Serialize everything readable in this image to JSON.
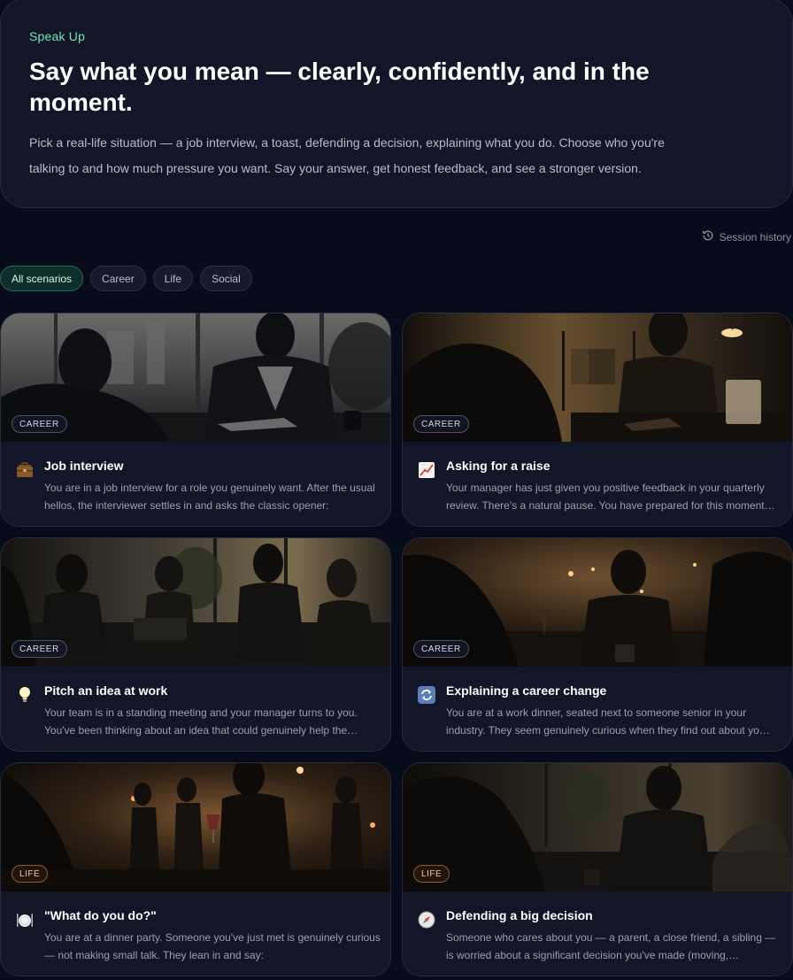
{
  "hero": {
    "eyebrow": "Speak Up",
    "title": "Say what you mean — clearly, confidently, and in the moment.",
    "intro": "Pick a real-life situation — a job interview, a toast, defending a decision, explaining what you do. Choose who you're talking to and how much pressure you want. Say your answer, get honest feedback, and see a stronger version."
  },
  "history": {
    "label": "Session history",
    "icon": "history-icon"
  },
  "filters": [
    "All scenarios",
    "Career",
    "Life",
    "Social"
  ],
  "active_filter": "All scenarios",
  "scenarios": [
    {
      "tag": "CAREER",
      "title": "Job interview",
      "icon": "briefcase-icon",
      "description": "You are in a job interview for a role you genuinely want. After the usual hellos, the interviewer settles in and asks the classic opener:"
    },
    {
      "tag": "CAREER",
      "title": "Asking for a raise",
      "icon": "chart-increasing-icon",
      "description": "Your manager has just given you positive feedback in your quarterly review. There's a natural pause. You have prepared for this moment…"
    },
    {
      "tag": "CAREER",
      "title": "Pitch an idea at work",
      "icon": "lightbulb-icon",
      "description": "Your team is in a standing meeting and your manager turns to you. You've been thinking about an idea that could genuinely help the…"
    },
    {
      "tag": "CAREER",
      "title": "Explaining a career change",
      "icon": "refresh-icon",
      "description": "You are at a work dinner, seated next to someone senior in your industry. They seem genuinely curious when they find out about yo…"
    },
    {
      "tag": "LIFE",
      "title": "\"What do you do?\"",
      "icon": "plate-icon",
      "description": "You are at a dinner party. Someone you've just met is genuinely curious — not making small talk. They lean in and say:"
    },
    {
      "tag": "LIFE",
      "title": "Defending a big decision",
      "icon": "compass-icon",
      "description": "Someone who cares about you — a parent, a close friend, a sibling — is worried about a significant decision you've made (moving,…"
    }
  ]
}
